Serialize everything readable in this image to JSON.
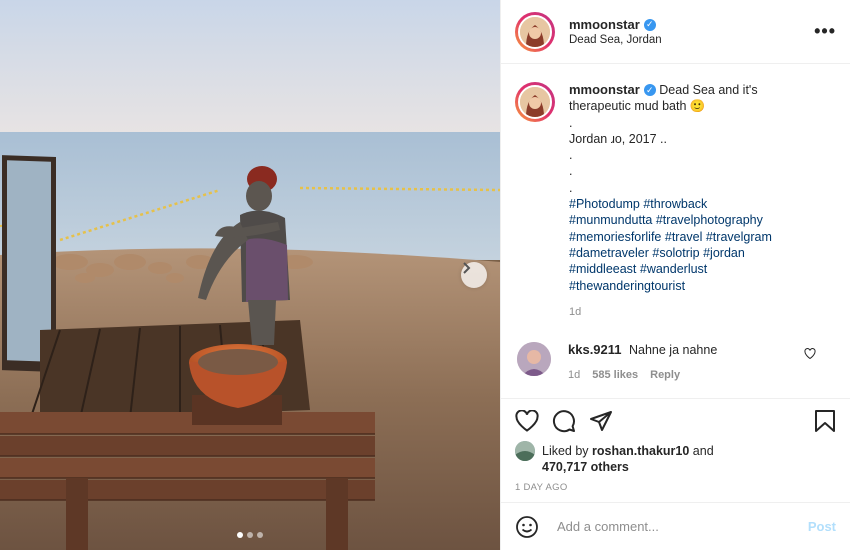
{
  "post": {
    "username": "mmoonstar",
    "location": "Dead Sea, Jordan",
    "more_label": "•••",
    "verified_icon": "verified-badge-icon",
    "caption": {
      "username": "mmoonstar",
      "text_line1": "Dead Sea and it's",
      "text_line2": "therapeutic mud bath 🙂",
      "dot1": ".",
      "date_line": "Jordan ɹo, 2017 ..",
      "dot2": ".",
      "dot3": ".",
      "dot4": ".",
      "hashtags": [
        "#Photodump #throwback",
        "#munmundutta #travelphotography",
        "#memoriesforlife #travel #travelgram",
        "#dametraveler #solotrip #jordan",
        "#middleeast #wanderlust",
        "#thewanderingtourist"
      ],
      "age": "1d"
    },
    "reply": {
      "username": "kks.9211",
      "text": "Nahne ja nahne",
      "age": "1d",
      "likes": "585 likes",
      "reply_label": "Reply"
    },
    "likes": {
      "prefix": "Liked by",
      "user": "roshan.thakur10",
      "conj": "and",
      "others": "470,717 others"
    },
    "time_ago": "1 DAY AGO",
    "comment_box": {
      "placeholder": "Add a comment...",
      "post_label": "Post"
    },
    "carousel": {
      "slides": 3,
      "active_index": 1
    }
  },
  "colors": {
    "link": "#00376b",
    "verified": "#3897f0",
    "post_button_disabled": "#b2dffc",
    "muted": "#8e8e8e"
  }
}
